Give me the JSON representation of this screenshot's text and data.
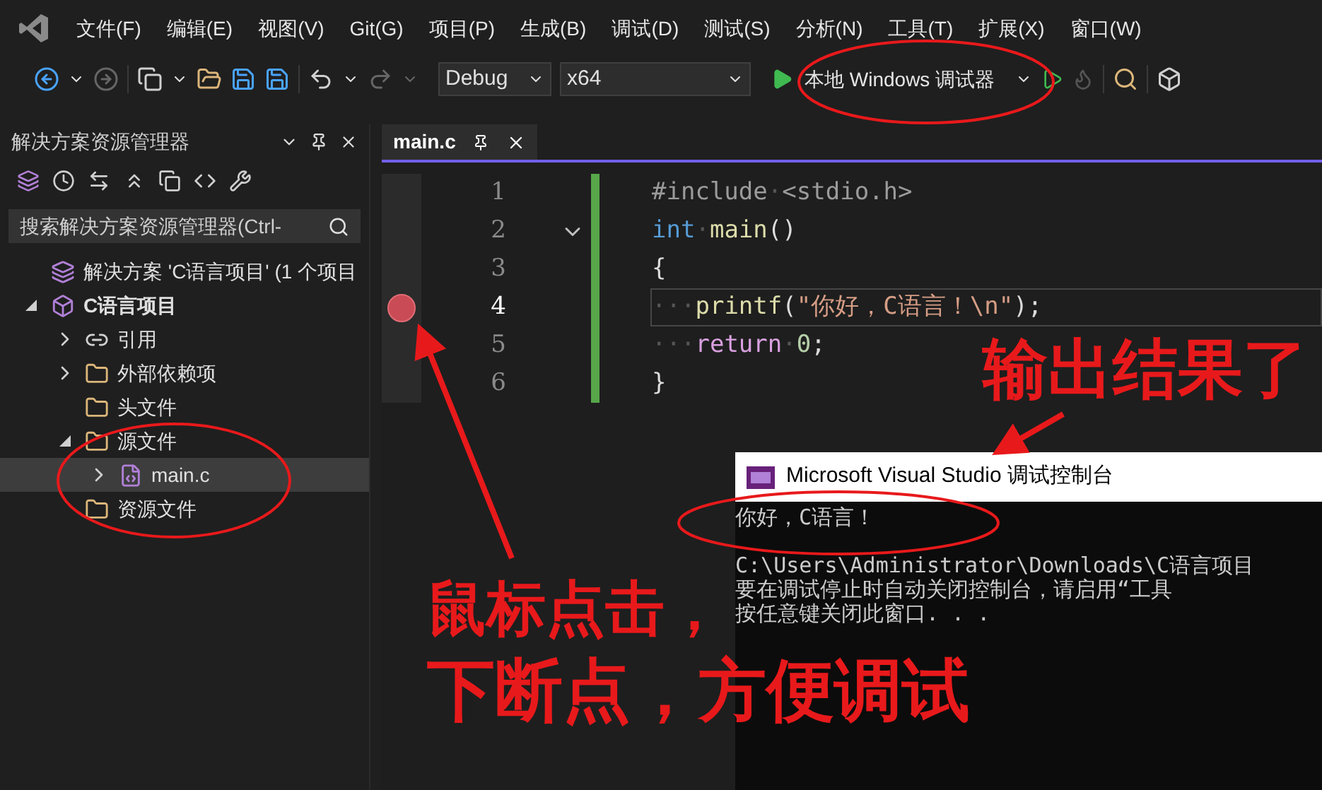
{
  "menu": [
    "文件(F)",
    "编辑(E)",
    "视图(V)",
    "Git(G)",
    "项目(P)",
    "生成(B)",
    "调试(D)",
    "测试(S)",
    "分析(N)",
    "工具(T)",
    "扩展(X)",
    "窗口(W)"
  ],
  "toolbar": {
    "configuration": "Debug",
    "platform": "x64",
    "run_button": "本地 Windows 调试器"
  },
  "solution_explorer": {
    "title": "解决方案资源管理器",
    "search": {
      "placeholder": "搜索解决方案资源管理器(Ctrl-"
    },
    "tree": [
      {
        "label": "解决方案 'C语言项目' (1 个项目",
        "kind": "solution",
        "selected": false,
        "children": [
          {
            "label": "C语言项目",
            "kind": "project",
            "expanded": true,
            "selected": false,
            "children": [
              {
                "label": "引用",
                "kind": "references",
                "expanded": false,
                "selected": false
              },
              {
                "label": "外部依赖项",
                "kind": "external",
                "expanded": false,
                "selected": false
              },
              {
                "label": "头文件",
                "kind": "filter",
                "selected": false
              },
              {
                "label": "源文件",
                "kind": "filter",
                "expanded": true,
                "selected": false,
                "children": [
                  {
                    "label": "main.c",
                    "kind": "file",
                    "expanded": false,
                    "selected": true
                  }
                ]
              },
              {
                "label": "资源文件",
                "kind": "filter",
                "selected": false
              }
            ]
          }
        ]
      }
    ]
  },
  "editor": {
    "tabs": [
      {
        "label": "main.c",
        "selected": true
      }
    ],
    "lines": [
      {
        "number": "1",
        "breakpoint": false,
        "fold": false,
        "current": false,
        "tokens": [
          {
            "text": "#include",
            "kind": "preprocessor"
          },
          {
            "text": "·",
            "kind": "whitespace"
          },
          {
            "text": "<stdio.h>",
            "kind": "preprocessor"
          }
        ]
      },
      {
        "number": "2",
        "breakpoint": false,
        "fold": true,
        "current": false,
        "tokens": [
          {
            "text": "int",
            "kind": "keyword"
          },
          {
            "text": "·",
            "kind": "whitespace"
          },
          {
            "text": "main",
            "kind": "function"
          },
          {
            "text": "()",
            "kind": "plain"
          }
        ]
      },
      {
        "number": "3",
        "breakpoint": false,
        "fold": false,
        "current": false,
        "tokens": [
          {
            "text": "{",
            "kind": "plain"
          }
        ]
      },
      {
        "number": "4",
        "breakpoint": true,
        "fold": false,
        "current": true,
        "tokens": [
          {
            "text": "···",
            "kind": "whitespace"
          },
          {
            "text": "printf",
            "kind": "function"
          },
          {
            "text": "(",
            "kind": "plain"
          },
          {
            "text": "\"你好，C语言！\\n\"",
            "kind": "string"
          },
          {
            "text": ");",
            "kind": "plain"
          }
        ]
      },
      {
        "number": "5",
        "breakpoint": false,
        "fold": false,
        "current": false,
        "tokens": [
          {
            "text": "···",
            "kind": "whitespace"
          },
          {
            "text": "return",
            "kind": "control"
          },
          {
            "text": "·",
            "kind": "whitespace"
          },
          {
            "text": "0",
            "kind": "number"
          },
          {
            "text": ";",
            "kind": "plain"
          }
        ]
      },
      {
        "number": "6",
        "breakpoint": false,
        "fold": false,
        "current": false,
        "tokens": [
          {
            "text": "}",
            "kind": "plain"
          }
        ]
      }
    ]
  },
  "console": {
    "title": "Microsoft Visual Studio 调试控制台",
    "output": [
      "你好，C语言！"
    ],
    "messages": [
      "C:\\Users\\Administrator\\Downloads\\C语言项目",
      "要在调试停止时自动关闭控制台，请启用“工具",
      "按任意键关闭此窗口. . ."
    ]
  },
  "annotations": [
    {
      "kind": "callout",
      "lines": [
        "输出结果了"
      ]
    },
    {
      "kind": "callout",
      "lines": [
        "鼠标点击，",
        "下断点，方便调试"
      ]
    }
  ]
}
